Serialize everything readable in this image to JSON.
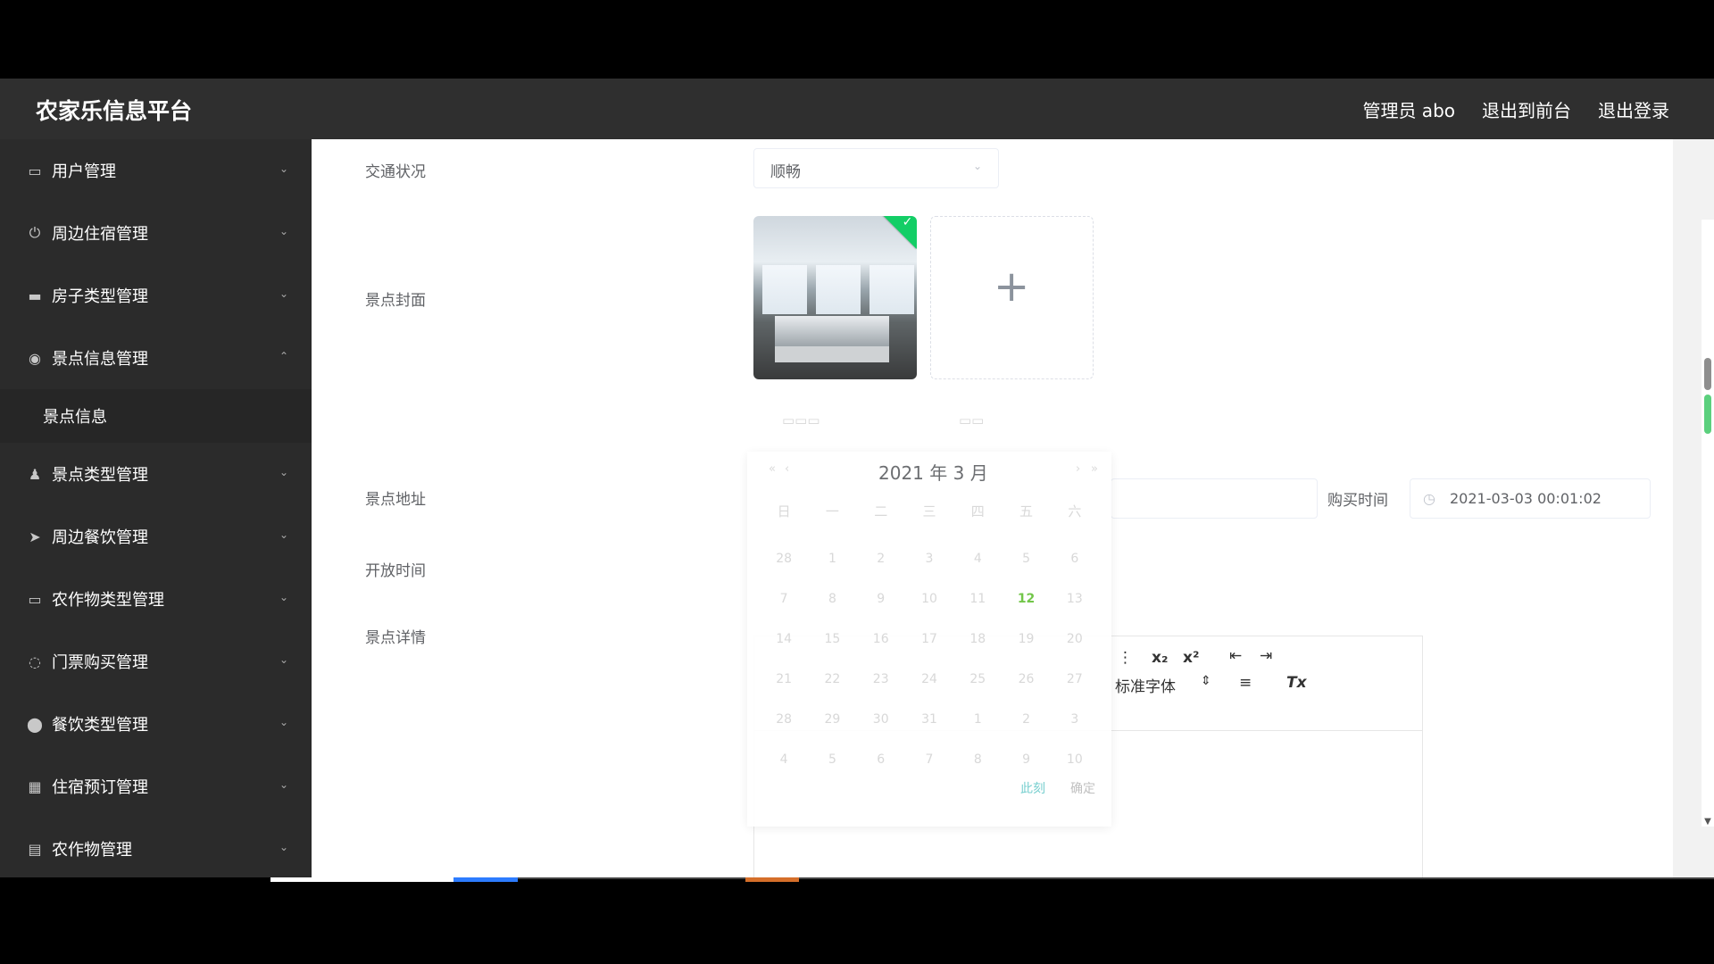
{
  "header": {
    "brand": "农家乐信息平台",
    "user": "管理员 abo",
    "front": "退出到前台",
    "logout": "退出登录"
  },
  "sidebar": {
    "items": [
      {
        "label": "用户管理",
        "icon": "user-manage-icon"
      },
      {
        "label": "周边住宿管理",
        "icon": "power-icon"
      },
      {
        "label": "房子类型管理",
        "icon": "house-icon"
      },
      {
        "label": "景点信息管理",
        "icon": "compass-icon"
      },
      {
        "label": "景点类型管理",
        "icon": "person-icon"
      },
      {
        "label": "周边餐饮管理",
        "icon": "location-arrow-icon"
      },
      {
        "label": "农作物类型管理",
        "icon": "monitor-icon"
      },
      {
        "label": "门票购买管理",
        "icon": "globe-icon"
      },
      {
        "label": "餐饮类型管理",
        "icon": "pin-icon"
      },
      {
        "label": "住宿预订管理",
        "icon": "grid-icon"
      },
      {
        "label": "农作物管理",
        "icon": "chat-icon"
      }
    ],
    "active_sub": "景点信息"
  },
  "form": {
    "traffic_label": "交通状况",
    "traffic_value": "顺畅",
    "cover_label": "景点封面",
    "address_label": "景点地址",
    "buy_time_label": "购买时间",
    "buy_time_value": "2021-03-03 00:01:02",
    "open_time_label": "开放时间",
    "detail_label": "景点详情"
  },
  "calendar": {
    "title": "2021 年 3 月",
    "weekdays": [
      "日",
      "一",
      "二",
      "三",
      "四",
      "五",
      "六"
    ],
    "days": [
      "28",
      "1",
      "2",
      "3",
      "4",
      "5",
      "6",
      "7",
      "8",
      "9",
      "10",
      "11",
      "12",
      "13",
      "14",
      "15",
      "16",
      "17",
      "18",
      "19",
      "20",
      "21",
      "22",
      "23",
      "24",
      "25",
      "26",
      "27",
      "28",
      "29",
      "30",
      "31",
      "1",
      "2",
      "3",
      "4",
      "5",
      "6",
      "7",
      "8",
      "9",
      "10"
    ],
    "today": "12",
    "footer_left": "此刻",
    "footer_right": "确定"
  },
  "editor": {
    "subscript": "x₂",
    "superscript": "x²",
    "font": "标准字体"
  }
}
